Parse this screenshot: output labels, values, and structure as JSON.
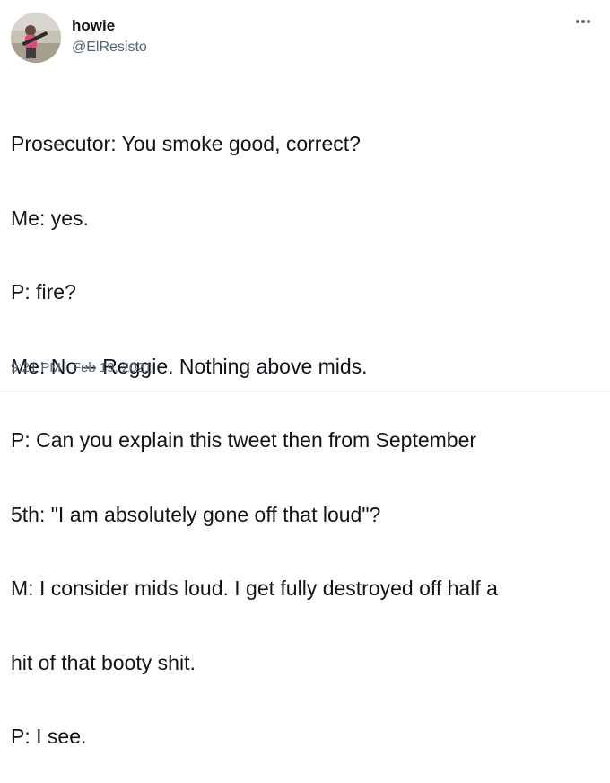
{
  "author": {
    "display_name": "howie",
    "handle": "@ElResisto",
    "avatar_icon": "profile-photo"
  },
  "menu": {
    "more_icon": "more-horizontal-icon"
  },
  "tweet": {
    "lines": [
      "Prosecutor: You smoke good, correct?",
      "Me: yes.",
      "P: fire?",
      "Me: No -- Reggie. Nothing above mids.",
      "P: Can you explain this tweet then from September",
      "5th: \"I am absolutely gone off that loud\"?",
      "M: I consider mids loud. I get fully destroyed off half a",
      "hit of that booty shit.",
      "P: I see."
    ],
    "time": "9:21 PM",
    "separator": "·",
    "date": "Feb 19, 2021"
  },
  "colors": {
    "text": "#0f1419",
    "secondary": "#536471",
    "background": "#ffffff"
  }
}
